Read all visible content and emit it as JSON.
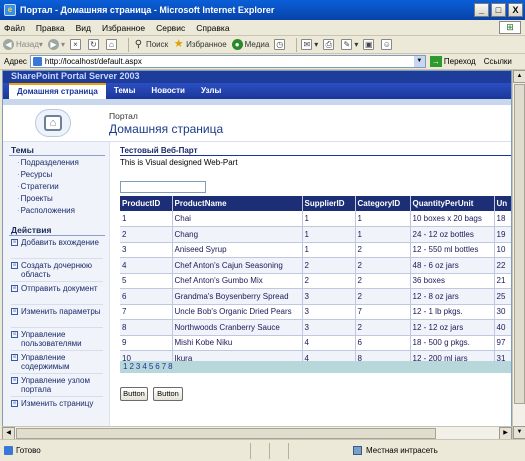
{
  "window": {
    "title": "Портал - Домашняя страница - Microsoft Internet Explorer",
    "controls": [
      "_",
      "□",
      "X"
    ]
  },
  "menu": [
    "Файл",
    "Правка",
    "Вид",
    "Избранное",
    "Сервис",
    "Справка"
  ],
  "toolbar": {
    "back": "Назад",
    "search": "Поиск",
    "favorites": "Избранное",
    "media": "Медиа"
  },
  "address": {
    "label": "Адрес",
    "url": "http://localhost/default.aspx",
    "go": "Переход",
    "links": "Ссылки"
  },
  "portal": {
    "brand": "SharePoint Portal Server 2003",
    "nav": [
      "Домашняя страница",
      "Темы",
      "Новости",
      "Узлы"
    ],
    "breadcrumb": "Портал",
    "page_title": "Домашняя страница"
  },
  "sidebar": {
    "topics_heading": "Темы",
    "topics": [
      "Подразделения",
      "Ресурсы",
      "Стратегии",
      "Проекты",
      "Расположения"
    ],
    "actions_heading": "Действия",
    "actions": [
      "Добавить вхождение",
      "Создать дочернюю область",
      "Отправить документ",
      "Изменить параметры",
      "Управление пользователями",
      "Управление содержимым",
      "Управление узлом портала",
      "Изменить страницу"
    ]
  },
  "webpart": {
    "title": "Тестовый Веб-Парт",
    "description": "This is Visual designed Web-Part",
    "input_value": "",
    "columns": [
      "ProductID",
      "ProductName",
      "SupplierID",
      "CategoryID",
      "QuantityPerUnit",
      "Un"
    ],
    "rows": [
      [
        "1",
        "Chai",
        "1",
        "1",
        "10 boxes x 20 bags",
        "18"
      ],
      [
        "2",
        "Chang",
        "1",
        "1",
        "24 - 12 oz bottles",
        "19"
      ],
      [
        "3",
        "Aniseed Syrup",
        "1",
        "2",
        "12 - 550 ml bottles",
        "10"
      ],
      [
        "4",
        "Chef Anton's Cajun Seasoning",
        "2",
        "2",
        "48 - 6 oz jars",
        "22"
      ],
      [
        "5",
        "Chef Anton's Gumbo Mix",
        "2",
        "2",
        "36 boxes",
        "21"
      ],
      [
        "6",
        "Grandma's Boysenberry Spread",
        "3",
        "2",
        "12 - 8 oz jars",
        "25"
      ],
      [
        "7",
        "Uncle Bob's Organic Dried Pears",
        "3",
        "7",
        "12 - 1 lb pkgs.",
        "30"
      ],
      [
        "8",
        "Northwoods Cranberry Sauce",
        "3",
        "2",
        "12 - 12 oz jars",
        "40"
      ],
      [
        "9",
        "Mishi Kobe Niku",
        "4",
        "6",
        "18 - 500 g pkgs.",
        "97"
      ],
      [
        "10",
        "Ikura",
        "4",
        "8",
        "12 - 200 ml jars",
        "31"
      ]
    ],
    "pager": [
      "1",
      "2",
      "3",
      "4",
      "5",
      "6",
      "7",
      "8"
    ],
    "button1": "Button",
    "button2": "Button"
  },
  "status": {
    "ready": "Готово",
    "zone": "Местная интрасеть"
  }
}
